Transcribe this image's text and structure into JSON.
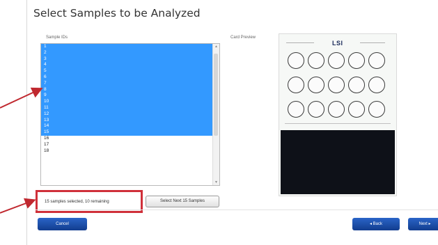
{
  "window": {
    "title": "Select Samples to be Analyzed"
  },
  "sample_list": {
    "header": "Sample IDs",
    "items": [
      "1",
      "2",
      "3",
      "4",
      "5",
      "6",
      "7",
      "8",
      "9",
      "10",
      "11",
      "12",
      "13",
      "14",
      "15",
      "16",
      "17",
      "18"
    ],
    "selected_count": 15
  },
  "card_preview": {
    "header": "Card Preview",
    "logo": "LSI",
    "rows": 3,
    "cols": 5
  },
  "status": {
    "text": "15 samples selected, 10 remaining"
  },
  "buttons": {
    "select_next": "Select Next 15 Samples",
    "cancel": "Cancel",
    "back": "◂ Back",
    "next": "Next ▸"
  },
  "colors": {
    "selection": "#3399ff",
    "highlight_box": "#d0303a",
    "button": "#1a4fae",
    "arrow": "#c0282f"
  }
}
